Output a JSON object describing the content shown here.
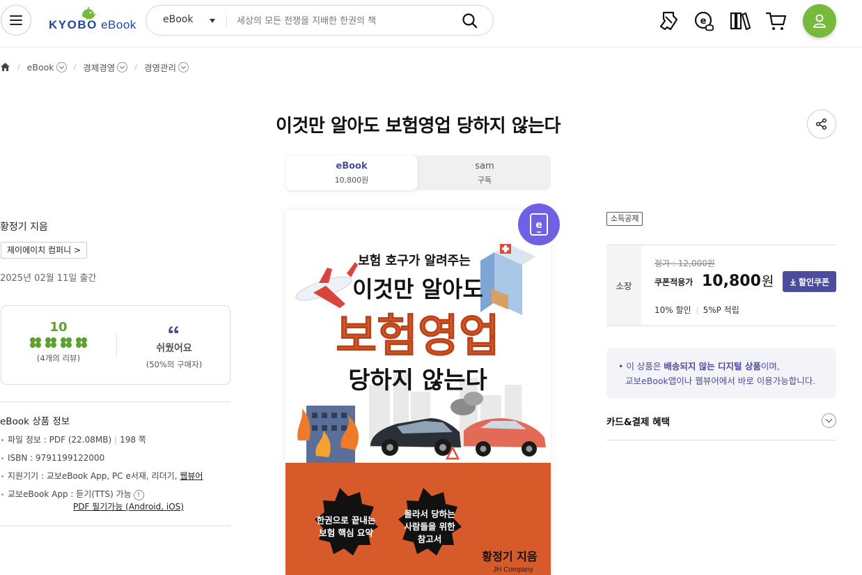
{
  "header": {
    "logo_brand": "KYOBO",
    "logo_product": "eBook",
    "search_category": "eBook",
    "search_placeholder": "세상의 모든 전쟁을 지배한 한권의 책"
  },
  "breadcrumb": {
    "items": [
      "eBook",
      "경제경영",
      "경영관리"
    ]
  },
  "product": {
    "title": "이것만 알아도 보험영업 당하지 않는다",
    "formats": [
      {
        "name": "eBook",
        "price": "10,800원"
      },
      {
        "name": "sam",
        "price": "구독"
      }
    ],
    "author": "황정기 지음",
    "publisher": "제이에이치 컴퍼니 >",
    "pub_date": "2025년 02월 11일 출간"
  },
  "review": {
    "score": "10",
    "review_count": "(4개의 리뷰)",
    "clover_count": 4,
    "keyword": "쉬웠어요",
    "keyword_ratio": "(50%의 구매자)"
  },
  "info": {
    "title": "eBook 상품 정보",
    "file_info_label": "파일 정보 : PDF (22.08MB)",
    "pages": "198 쪽",
    "isbn": "ISBN : 9791199122000",
    "devices": "지원기기 : 교보eBook App, PC e서재, 리더기,",
    "devices_link": "웹뷰어",
    "app_label": "교보eBook App : 듣기(TTS) 가능",
    "tts_info": "!",
    "pdf_note": "PDF 필기가능 (Android, iOS)"
  },
  "cover": {
    "tagline": "보험 호구가 알려주는",
    "line1": "이것만 알아도",
    "line2": "보험영업",
    "line3": "당하지 않는다",
    "badge1": [
      "한권으로 끝내는",
      "보험 핵심 요약"
    ],
    "badge2": [
      "몰라서 당하는",
      "사람들을 위한",
      "참고서"
    ],
    "author": "황정기 지음",
    "publisher": "JH Company",
    "ebook_badge": "e"
  },
  "price": {
    "tax_badge": "소득공제",
    "type_label": "소장",
    "original": "정가 : 12,000원",
    "coupon_label": "쿠폰적용가",
    "sale_amount": "10,800",
    "sale_unit": "원",
    "coupon_button": "할인쿠폰",
    "discount": "10% 할인",
    "points": "5%P 적립"
  },
  "notice": {
    "p1": "이 상품은 ",
    "p2": "배송되지 않는 디지털 상품",
    "p3": "이며,",
    "line2": "교보eBook앱이나 웹뷰어에서 바로 이용가능합니다."
  },
  "card": {
    "label": "카드&결제 혜택"
  },
  "colors": {
    "brand_blue": "#24479e",
    "brand_green": "#77b93b",
    "accent_purple": "#4b4c9b",
    "badge_purple": "#6f60e4",
    "cover_orange": "#d65a2a"
  }
}
